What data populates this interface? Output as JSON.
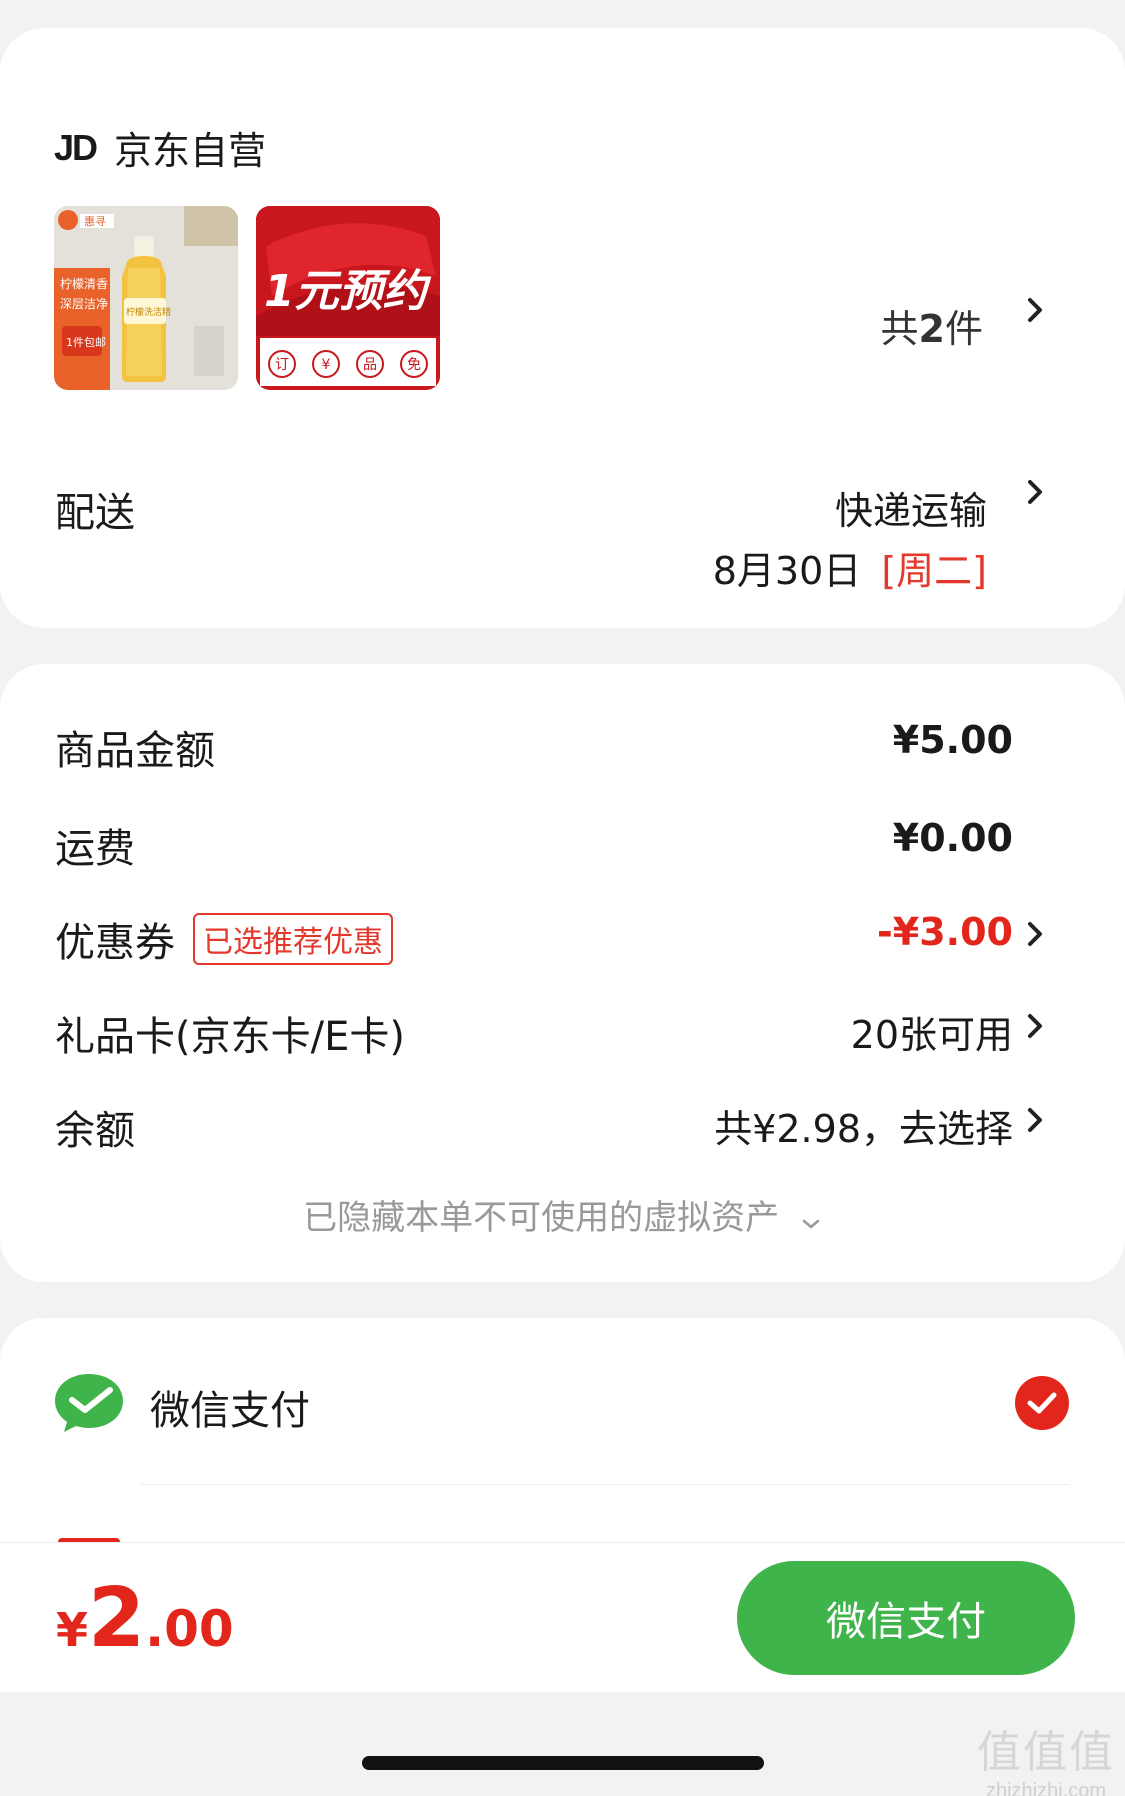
{
  "shop": {
    "logo_text": "JD",
    "name": "京东自营"
  },
  "products": {
    "thumb1": {
      "brand": "惠寻",
      "line1": "柠檬清香",
      "line2": "深层洁净",
      "badge": "1件包邮",
      "bottle_label": "柠檬洗洁精"
    },
    "thumb2": {
      "headline": "1元预约",
      "icons": [
        "订",
        "¥",
        "品",
        "免"
      ]
    },
    "count_prefix": "共",
    "count_num": "2",
    "count_suffix": "件"
  },
  "delivery": {
    "label": "配送",
    "method": "快递运输",
    "date": "8月30日",
    "weekday": "[周二]"
  },
  "price": {
    "goods_label": "商品金额",
    "goods_value": "¥5.00",
    "shipping_label": "运费",
    "shipping_value": "¥0.00",
    "coupon_label": "优惠券",
    "coupon_tag": "已选推荐优惠",
    "coupon_value": "-¥3.00",
    "giftcard_label": "礼品卡(京东卡/E卡)",
    "giftcard_value": "20张可用",
    "balance_label": "余额",
    "balance_value": "共¥2.98，去选择",
    "hidden_note": "已隐藏本单不可使用的虚拟资产"
  },
  "payment": {
    "method_label": "微信支付"
  },
  "bottom": {
    "currency": "¥",
    "total_int": "2",
    "total_dec": ".00",
    "pay_button": "微信支付"
  },
  "watermark": {
    "big": "值值值",
    "small": "zhizhizhi.com"
  },
  "colors": {
    "accent_red": "#e3261b",
    "wechat_green": "#3fb44b",
    "background": "#f2f2f2"
  }
}
